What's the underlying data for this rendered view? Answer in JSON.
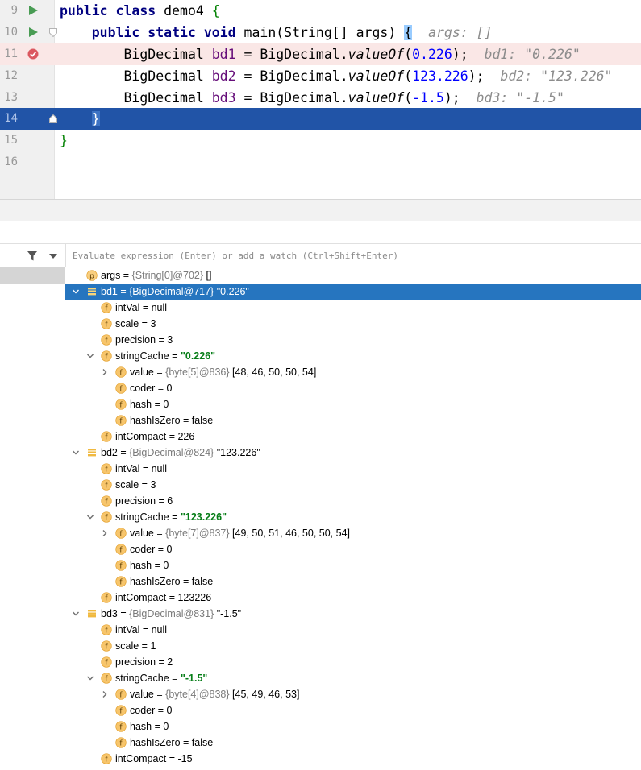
{
  "editor": {
    "lines": [
      {
        "num": "9",
        "parts": [
          [
            "kw",
            "public "
          ],
          [
            "kw",
            "class "
          ],
          [
            "plain",
            "demo4 "
          ],
          [
            "green",
            "{"
          ]
        ]
      },
      {
        "num": "10",
        "parts": [
          [
            "plain",
            "    "
          ],
          [
            "kw",
            "public "
          ],
          [
            "kw",
            "static "
          ],
          [
            "kw",
            "void "
          ],
          [
            "plain",
            "main(String[] args) "
          ],
          [
            "bracehl",
            "{"
          ],
          [
            "plain",
            "  "
          ],
          [
            "hint",
            "args: []"
          ]
        ]
      },
      {
        "num": "11",
        "parts": [
          [
            "plain",
            "        BigDecimal "
          ],
          [
            "var",
            "bd1"
          ],
          [
            "plain",
            " = BigDecimal."
          ],
          [
            "it",
            "valueOf"
          ],
          [
            "plain",
            "("
          ],
          [
            "num",
            "0.226"
          ],
          [
            "plain",
            ");  "
          ],
          [
            "hint",
            "bd1: \"0.226\""
          ]
        ]
      },
      {
        "num": "12",
        "parts": [
          [
            "plain",
            "        BigDecimal "
          ],
          [
            "var",
            "bd2"
          ],
          [
            "plain",
            " = BigDecimal."
          ],
          [
            "it",
            "valueOf"
          ],
          [
            "plain",
            "("
          ],
          [
            "num",
            "123.226"
          ],
          [
            "plain",
            ");  "
          ],
          [
            "hint",
            "bd2: \"123.226\""
          ]
        ]
      },
      {
        "num": "13",
        "parts": [
          [
            "plain",
            "        BigDecimal "
          ],
          [
            "var",
            "bd3"
          ],
          [
            "plain",
            " = BigDecimal."
          ],
          [
            "it",
            "valueOf"
          ],
          [
            "plain",
            "("
          ],
          [
            "num",
            "-1.5"
          ],
          [
            "plain",
            ");  "
          ],
          [
            "hint",
            "bd3: \"-1.5\""
          ]
        ]
      },
      {
        "num": "14",
        "parts": [
          [
            "plain",
            "    "
          ],
          [
            "bracehl",
            "}"
          ]
        ]
      },
      {
        "num": "15",
        "parts": [
          [
            "green",
            "}"
          ]
        ]
      },
      {
        "num": "16",
        "parts": []
      }
    ]
  },
  "debugger": {
    "watch_placeholder": "Evaluate expression (Enter) or add a watch (Ctrl+Shift+Enter)",
    "variables": [
      {
        "depth": 0,
        "arrow": "none",
        "icon": "p",
        "name": "args",
        "type": "{String[0]@702}",
        "value": "[]",
        "selected": false
      },
      {
        "depth": 0,
        "arrow": "expanded",
        "icon": "obj",
        "name": "bd1",
        "type": "{BigDecimal@717}",
        "value": "\"0.226\"",
        "selected": true
      },
      {
        "depth": 1,
        "arrow": "none",
        "icon": "f",
        "name": "intVal",
        "type": "",
        "value": "null"
      },
      {
        "depth": 1,
        "arrow": "none",
        "icon": "f",
        "name": "scale",
        "type": "",
        "value": "3"
      },
      {
        "depth": 1,
        "arrow": "none",
        "icon": "f",
        "name": "precision",
        "type": "",
        "value": "3"
      },
      {
        "depth": 1,
        "arrow": "expanded",
        "icon": "f",
        "name": "stringCache",
        "type": "",
        "value": "\"0.226\"",
        "str": true
      },
      {
        "depth": 2,
        "arrow": "collapsed",
        "icon": "f",
        "name": "value",
        "type": "{byte[5]@836}",
        "value": "[48, 46, 50, 50, 54]"
      },
      {
        "depth": 2,
        "arrow": "none",
        "icon": "f",
        "name": "coder",
        "type": "",
        "value": "0"
      },
      {
        "depth": 2,
        "arrow": "none",
        "icon": "f",
        "name": "hash",
        "type": "",
        "value": "0"
      },
      {
        "depth": 2,
        "arrow": "none",
        "icon": "f",
        "name": "hashIsZero",
        "type": "",
        "value": "false"
      },
      {
        "depth": 1,
        "arrow": "none",
        "icon": "f",
        "name": "intCompact",
        "type": "",
        "value": "226"
      },
      {
        "depth": 0,
        "arrow": "expanded",
        "icon": "obj",
        "name": "bd2",
        "type": "{BigDecimal@824}",
        "value": "\"123.226\""
      },
      {
        "depth": 1,
        "arrow": "none",
        "icon": "f",
        "name": "intVal",
        "type": "",
        "value": "null"
      },
      {
        "depth": 1,
        "arrow": "none",
        "icon": "f",
        "name": "scale",
        "type": "",
        "value": "3"
      },
      {
        "depth": 1,
        "arrow": "none",
        "icon": "f",
        "name": "precision",
        "type": "",
        "value": "6"
      },
      {
        "depth": 1,
        "arrow": "expanded",
        "icon": "f",
        "name": "stringCache",
        "type": "",
        "value": "\"123.226\"",
        "str": true
      },
      {
        "depth": 2,
        "arrow": "collapsed",
        "icon": "f",
        "name": "value",
        "type": "{byte[7]@837}",
        "value": "[49, 50, 51, 46, 50, 50, 54]"
      },
      {
        "depth": 2,
        "arrow": "none",
        "icon": "f",
        "name": "coder",
        "type": "",
        "value": "0"
      },
      {
        "depth": 2,
        "arrow": "none",
        "icon": "f",
        "name": "hash",
        "type": "",
        "value": "0"
      },
      {
        "depth": 2,
        "arrow": "none",
        "icon": "f",
        "name": "hashIsZero",
        "type": "",
        "value": "false"
      },
      {
        "depth": 1,
        "arrow": "none",
        "icon": "f",
        "name": "intCompact",
        "type": "",
        "value": "123226"
      },
      {
        "depth": 0,
        "arrow": "expanded",
        "icon": "obj",
        "name": "bd3",
        "type": "{BigDecimal@831}",
        "value": "\"-1.5\""
      },
      {
        "depth": 1,
        "arrow": "none",
        "icon": "f",
        "name": "intVal",
        "type": "",
        "value": "null"
      },
      {
        "depth": 1,
        "arrow": "none",
        "icon": "f",
        "name": "scale",
        "type": "",
        "value": "1"
      },
      {
        "depth": 1,
        "arrow": "none",
        "icon": "f",
        "name": "precision",
        "type": "",
        "value": "2"
      },
      {
        "depth": 1,
        "arrow": "expanded",
        "icon": "f",
        "name": "stringCache",
        "type": "",
        "value": "\"-1.5\"",
        "str": true
      },
      {
        "depth": 2,
        "arrow": "collapsed",
        "icon": "f",
        "name": "value",
        "type": "{byte[4]@838}",
        "value": "[45, 49, 46, 53]"
      },
      {
        "depth": 2,
        "arrow": "none",
        "icon": "f",
        "name": "coder",
        "type": "",
        "value": "0"
      },
      {
        "depth": 2,
        "arrow": "none",
        "icon": "f",
        "name": "hash",
        "type": "",
        "value": "0"
      },
      {
        "depth": 2,
        "arrow": "none",
        "icon": "f",
        "name": "hashIsZero",
        "type": "",
        "value": "false"
      },
      {
        "depth": 1,
        "arrow": "none",
        "icon": "f",
        "name": "intCompact",
        "type": "",
        "value": "-15"
      }
    ]
  },
  "colors": {
    "keyword": "#000080",
    "number": "#0000ff",
    "local_var": "#660e7a",
    "inline_hint": "#8c8c8c",
    "breakpoint_line": "#fae7e6",
    "execution_line": "#2154a7",
    "selected_row": "#2675bf",
    "field_icon": "#f4af3d",
    "string_value": "#067d17",
    "run_gutter": "#499c54",
    "breakpoint": "#db5860"
  }
}
